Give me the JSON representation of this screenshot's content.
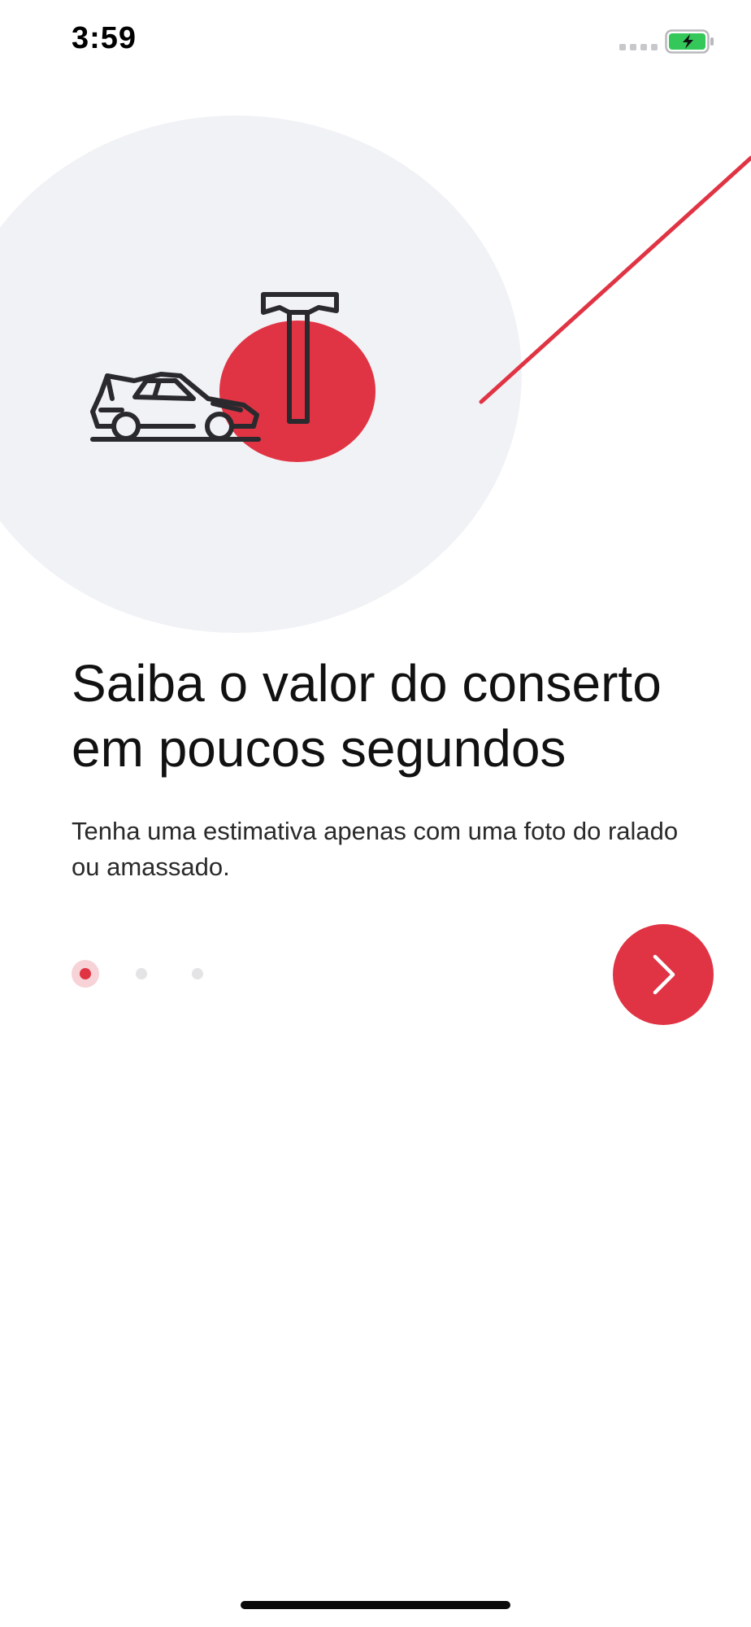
{
  "status_bar": {
    "time": "3:59",
    "signal_icon": "signal-dots-icon",
    "battery_icon": "battery-charging-icon",
    "battery_color": "#34c759"
  },
  "hero": {
    "illustration": "car-repair-hammer-illustration",
    "background_circle_color": "#f1f2f6",
    "accent_color": "#e03444"
  },
  "content": {
    "headline": "Saiba o valor do conserto em poucos segundos",
    "description": "Tenha uma estimativa apenas com uma foto do ralado ou amassado."
  },
  "pager": {
    "active_index": 0,
    "total_pages": 3
  },
  "next_button": {
    "icon": "chevron-right-icon",
    "color": "#e03444"
  }
}
